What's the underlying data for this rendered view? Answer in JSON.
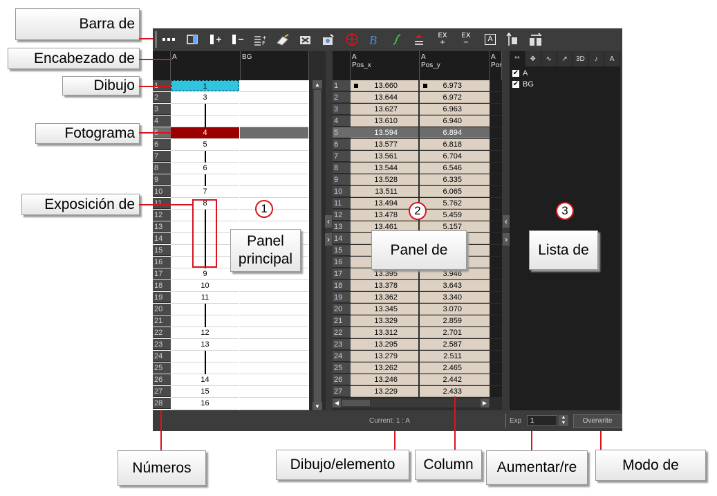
{
  "callouts": {
    "barra": "Barra de",
    "encabezado": "Encabezado de",
    "dibujo": "Dibujo",
    "fotograma": "Fotograma",
    "exposicion": "Exposición de",
    "panel_principal_1": "Panel",
    "panel_principal_2": "principal",
    "panel_de": "Panel de",
    "lista_de": "Lista de",
    "numeros": "Números",
    "dibujo_elemento": "Dibujo/elemento",
    "column": "Column",
    "aumentar": "Aumentar/re",
    "modo": "Modo de"
  },
  "markers": [
    "1",
    "2",
    "3"
  ],
  "toolbar": {
    "icons": [
      "more-icon",
      "keyframe-icon",
      "add-column-icon",
      "remove-column-icon",
      "fill-empty-icon",
      "paint-icon",
      "select-tool-icon",
      "camera-icon",
      "target-icon",
      "brush-icon",
      "curve-icon",
      "onion-skin-icon",
      "exposure-plus-icon",
      "exposure-minus-icon",
      "text-icon",
      "increase-icon",
      "arrange-icon"
    ],
    "ex_plus": "EX\n+",
    "ex_minus": "EX\n−",
    "text_btn": "A"
  },
  "main_panel": {
    "headers": [
      "A",
      "BG"
    ],
    "rows": [
      {
        "n": "1",
        "a": "1",
        "state": "selected"
      },
      {
        "n": "2",
        "a": "3"
      },
      {
        "n": "3",
        "a": "",
        "hold": true
      },
      {
        "n": "4",
        "a": "",
        "hold": true
      },
      {
        "n": "5",
        "a": "4",
        "state": "current"
      },
      {
        "n": "6",
        "a": "5"
      },
      {
        "n": "7",
        "a": "",
        "hold": true
      },
      {
        "n": "8",
        "a": "6"
      },
      {
        "n": "9",
        "a": "",
        "hold": true
      },
      {
        "n": "10",
        "a": "7"
      },
      {
        "n": "11",
        "a": "8"
      },
      {
        "n": "12",
        "a": "",
        "hold": true
      },
      {
        "n": "13",
        "a": "",
        "hold": true
      },
      {
        "n": "14",
        "a": "",
        "hold": true
      },
      {
        "n": "15",
        "a": "",
        "hold": true
      },
      {
        "n": "16",
        "a": "",
        "hold": true
      },
      {
        "n": "17",
        "a": "9"
      },
      {
        "n": "18",
        "a": "10"
      },
      {
        "n": "19",
        "a": "11"
      },
      {
        "n": "20",
        "a": "",
        "hold": true
      },
      {
        "n": "21",
        "a": "",
        "hold": true
      },
      {
        "n": "22",
        "a": "12"
      },
      {
        "n": "23",
        "a": "13"
      },
      {
        "n": "24",
        "a": "",
        "hold": true
      },
      {
        "n": "25",
        "a": "",
        "hold": true
      },
      {
        "n": "26",
        "a": "14"
      },
      {
        "n": "27",
        "a": "15"
      },
      {
        "n": "28",
        "a": "16"
      }
    ]
  },
  "function_panel": {
    "headers": [
      {
        "layer": "A",
        "param": "Pos_x"
      },
      {
        "layer": "A",
        "param": "Pos_y"
      },
      {
        "layer": "A",
        "param": "Pos"
      }
    ],
    "rows": [
      {
        "n": "1",
        "x": "13.660",
        "y": "6.973"
      },
      {
        "n": "2",
        "x": "13.644",
        "y": "6.972"
      },
      {
        "n": "3",
        "x": "13.627",
        "y": "6.963"
      },
      {
        "n": "4",
        "x": "13.610",
        "y": "6.940"
      },
      {
        "n": "5",
        "x": "13.594",
        "y": "6.894"
      },
      {
        "n": "6",
        "x": "13.577",
        "y": "6.818"
      },
      {
        "n": "7",
        "x": "13.561",
        "y": "6.704"
      },
      {
        "n": "8",
        "x": "13.544",
        "y": "6.546"
      },
      {
        "n": "9",
        "x": "13.528",
        "y": "6.335"
      },
      {
        "n": "10",
        "x": "13.511",
        "y": "6.065"
      },
      {
        "n": "11",
        "x": "13.494",
        "y": "5.762"
      },
      {
        "n": "12",
        "x": "13.478",
        "y": "5.459"
      },
      {
        "n": "13",
        "x": "13.461",
        "y": "5.157"
      },
      {
        "n": "14",
        "x": "",
        "y": ""
      },
      {
        "n": "15",
        "x": "",
        "y": ""
      },
      {
        "n": "16",
        "x": "",
        "y": ""
      },
      {
        "n": "17",
        "x": "13.395",
        "y": "3.946"
      },
      {
        "n": "18",
        "x": "13.378",
        "y": "3.643"
      },
      {
        "n": "19",
        "x": "13.362",
        "y": "3.340"
      },
      {
        "n": "20",
        "x": "13.345",
        "y": "3.070"
      },
      {
        "n": "21",
        "x": "13.329",
        "y": "2.859"
      },
      {
        "n": "22",
        "x": "13.312",
        "y": "2.701"
      },
      {
        "n": "23",
        "x": "13.295",
        "y": "2.587"
      },
      {
        "n": "24",
        "x": "13.279",
        "y": "2.511"
      },
      {
        "n": "25",
        "x": "13.262",
        "y": "2.465"
      },
      {
        "n": "26",
        "x": "13.246",
        "y": "2.442"
      },
      {
        "n": "27",
        "x": "13.229",
        "y": "2.433"
      }
    ]
  },
  "layer_list": {
    "tabs": [
      "**",
      "❖",
      "∿",
      "↗",
      "3D",
      "♪",
      "A"
    ],
    "items": [
      {
        "label": "A",
        "checked": true
      },
      {
        "label": "BG",
        "checked": true
      }
    ]
  },
  "status": {
    "current": "Current: 1 : A",
    "exp_label": "Exp",
    "exp_value": "1",
    "overwrite": "Overwrite"
  },
  "colors": {
    "selected": "#30c4de",
    "current": "#9a0000",
    "function_cell": "#ddd1c4",
    "callout_line": "#d8141f"
  }
}
